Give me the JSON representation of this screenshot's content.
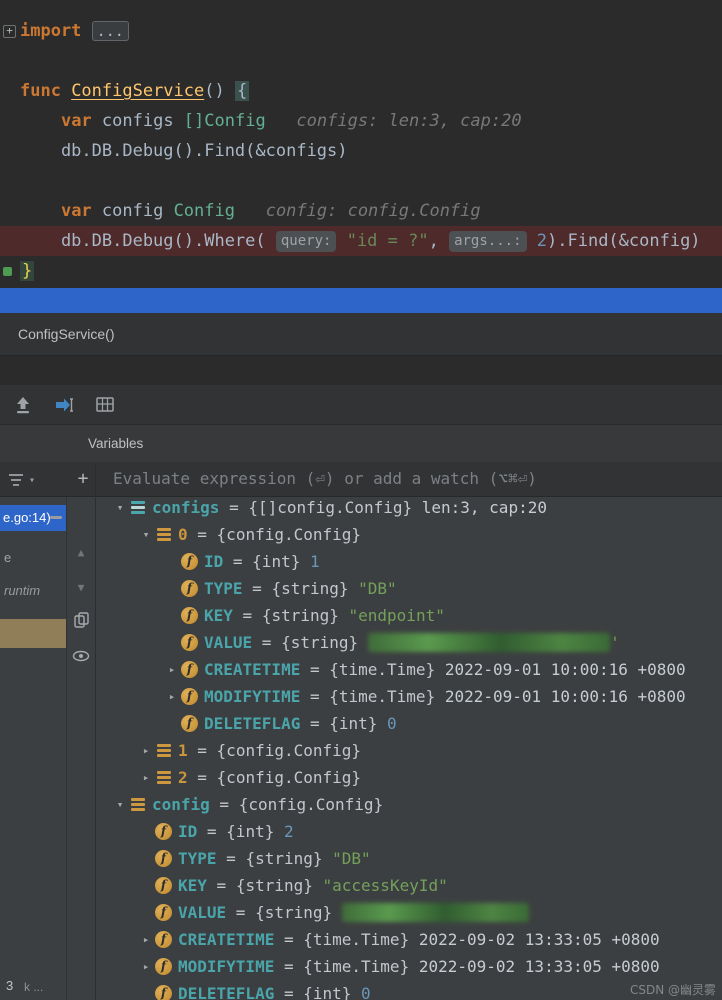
{
  "watermark": "CSDN @幽灵雾",
  "colors": {
    "selection_blue": "#2d65c8",
    "execution_line_bg": "#4e2a2a",
    "keyword": "#cc7832",
    "function_name": "#ffc66d",
    "type": "#64b092",
    "string": "#6a8759",
    "number": "#6897bb",
    "inline_hint": "#787878",
    "variable_name": "#4aa5aa",
    "index_name": "#c9953d",
    "field_icon": "#cd9840",
    "frame_tan": "#8f7e58"
  },
  "icons": {
    "plus": "+",
    "scroll_up": "▲",
    "scroll_down": "▼",
    "filter_caret": "▾",
    "chevron_down": "▾",
    "chevron_right": "▸",
    "fold_plus": "+"
  },
  "editor": {
    "lines": [
      {
        "gutter": "fold-plus",
        "segments": [
          {
            "t": "import",
            "c": "kw"
          },
          {
            "t": " ",
            "c": "plain"
          },
          {
            "t": "...",
            "c": "fold"
          }
        ]
      },
      {
        "segments": []
      },
      {
        "segments": [
          {
            "t": "func ",
            "c": "kw"
          },
          {
            "t": "ConfigService",
            "c": "fn"
          },
          {
            "t": "() ",
            "c": "plain"
          },
          {
            "t": "{",
            "c": "brace"
          }
        ]
      },
      {
        "segments": [
          {
            "t": "    ",
            "c": "plain"
          },
          {
            "t": "var",
            "c": "kw"
          },
          {
            "t": " configs ",
            "c": "plain"
          },
          {
            "t": "[]Config",
            "c": "type"
          },
          {
            "t": "   ",
            "c": "plain"
          },
          {
            "t": "configs: len:3, cap:20",
            "c": "hint"
          }
        ]
      },
      {
        "segments": [
          {
            "t": "    db.DB.Debug().Find(&configs)",
            "c": "plain"
          }
        ]
      },
      {
        "segments": []
      },
      {
        "segments": [
          {
            "t": "    ",
            "c": "plain"
          },
          {
            "t": "var",
            "c": "kw"
          },
          {
            "t": " config ",
            "c": "plain"
          },
          {
            "t": "Config",
            "c": "type"
          },
          {
            "t": "   ",
            "c": "plain"
          },
          {
            "t": "config: config.Config",
            "c": "hint"
          }
        ]
      },
      {
        "exec": true,
        "segments": [
          {
            "t": "    db.DB.Debug().Where( ",
            "c": "plain"
          },
          {
            "t": "query:",
            "c": "chip"
          },
          {
            "t": " ",
            "c": "plain"
          },
          {
            "t": "\"id = ?\"",
            "c": "str"
          },
          {
            "t": ", ",
            "c": "plain"
          },
          {
            "t": "args...:",
            "c": "chip"
          },
          {
            "t": " ",
            "c": "plain"
          },
          {
            "t": "2",
            "c": "num"
          },
          {
            "t": ").Find(&config)",
            "c": "plain"
          }
        ]
      },
      {
        "gutter": "fold-end",
        "segments": [
          {
            "t": "}",
            "c": "brace-end"
          }
        ]
      }
    ]
  },
  "debug": {
    "breadcrumb": "ConfigService()",
    "tab_label": "Variables",
    "evaluate_placeholder": "Evaluate expression (⏎) or add a watch (⌥⌘⏎)",
    "frames": {
      "selected": "e.go:14)",
      "items": [
        {
          "label": "e"
        },
        {
          "label": "runtim"
        }
      ],
      "bottom": [
        "3",
        "k ..."
      ]
    },
    "variables": [
      {
        "level": 0,
        "chevron": "down",
        "icon": "array",
        "name": "configs",
        "type": "{[]config.Config}",
        "value": "len:3, cap:20",
        "vclass": "plain"
      },
      {
        "level": 1,
        "chevron": "down",
        "icon": "struct",
        "name": "0",
        "nclass": "idx",
        "type": "{config.Config}"
      },
      {
        "level": 2,
        "chevron": "none",
        "icon": "field",
        "name": "ID",
        "type": "{int}",
        "value": "1",
        "vclass": "num"
      },
      {
        "level": 2,
        "chevron": "none",
        "icon": "field",
        "name": "TYPE",
        "type": "{string}",
        "value": "\"DB\"",
        "vclass": "str"
      },
      {
        "level": 2,
        "chevron": "none",
        "icon": "field",
        "name": "KEY",
        "type": "{string}",
        "value": "\"endpoint\"",
        "vclass": "str"
      },
      {
        "level": 2,
        "chevron": "none",
        "icon": "field",
        "name": "VALUE",
        "type": "{string}",
        "redacted": "w1",
        "after": "'"
      },
      {
        "level": 2,
        "chevron": "right",
        "icon": "field",
        "name": "CREATETIME",
        "type": "{time.Time}",
        "value": "2022-09-01 10:00:16 +0800",
        "vclass": "plain"
      },
      {
        "level": 2,
        "chevron": "right",
        "icon": "field",
        "name": "MODIFYTIME",
        "type": "{time.Time}",
        "value": "2022-09-01 10:00:16 +0800",
        "vclass": "plain"
      },
      {
        "level": 2,
        "chevron": "none",
        "icon": "field",
        "name": "DELETEFLAG",
        "type": "{int}",
        "value": "0",
        "vclass": "num"
      },
      {
        "level": 1,
        "chevron": "right",
        "icon": "struct",
        "name": "1",
        "nclass": "idx",
        "type": "{config.Config}"
      },
      {
        "level": 1,
        "chevron": "right",
        "icon": "struct",
        "name": "2",
        "nclass": "idx",
        "type": "{config.Config}"
      },
      {
        "level": 0,
        "chevron": "down",
        "icon": "struct",
        "name": "config",
        "type": "{config.Config}"
      },
      {
        "level": 1,
        "chevron": "none",
        "icon": "field",
        "name": "ID",
        "type": "{int}",
        "value": "2",
        "vclass": "num"
      },
      {
        "level": 1,
        "chevron": "none",
        "icon": "field",
        "name": "TYPE",
        "type": "{string}",
        "value": "\"DB\"",
        "vclass": "str"
      },
      {
        "level": 1,
        "chevron": "none",
        "icon": "field",
        "name": "KEY",
        "type": "{string}",
        "value": "\"accessKeyId\"",
        "vclass": "str"
      },
      {
        "level": 1,
        "chevron": "none",
        "icon": "field",
        "name": "VALUE",
        "type": "{string}",
        "redacted": "w2"
      },
      {
        "level": 1,
        "chevron": "right",
        "icon": "field",
        "name": "CREATETIME",
        "type": "{time.Time}",
        "value": "2022-09-02 13:33:05 +0800",
        "vclass": "plain"
      },
      {
        "level": 1,
        "chevron": "right",
        "icon": "field",
        "name": "MODIFYTIME",
        "type": "{time.Time}",
        "value": "2022-09-02 13:33:05 +0800",
        "vclass": "plain"
      },
      {
        "level": 1,
        "chevron": "none",
        "icon": "field",
        "name": "DELETEFLAG",
        "type": "{int}",
        "value": "0",
        "vclass": "num"
      }
    ]
  }
}
